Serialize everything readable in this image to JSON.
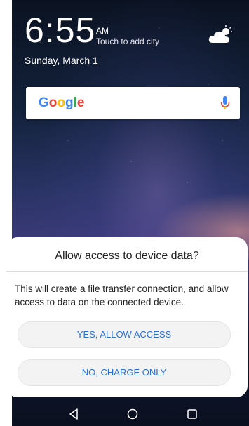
{
  "lockscreen": {
    "time": "6:55",
    "ampm": "AM",
    "city_prompt": "Touch to add city",
    "date": "Sunday, March 1",
    "weather_icon": "partly-cloudy-icon"
  },
  "search": {
    "logo_letters": [
      "G",
      "o",
      "o",
      "g",
      "l",
      "e"
    ],
    "mic_icon": "microphone-icon"
  },
  "dialog": {
    "title": "Allow access to device data?",
    "message": "This will create a file transfer connection, and allow access to data on the connected device.",
    "allow_button": "YES, ALLOW ACCESS",
    "charge_button": "NO, CHARGE ONLY"
  },
  "navigation": {
    "items": [
      "back-icon",
      "home-icon",
      "recents-icon"
    ]
  },
  "colors": {
    "button_text": "#2a6fd6",
    "google_blue": "#4285F4",
    "google_red": "#EA4335",
    "google_yellow": "#FBBC05",
    "google_green": "#34A853"
  }
}
